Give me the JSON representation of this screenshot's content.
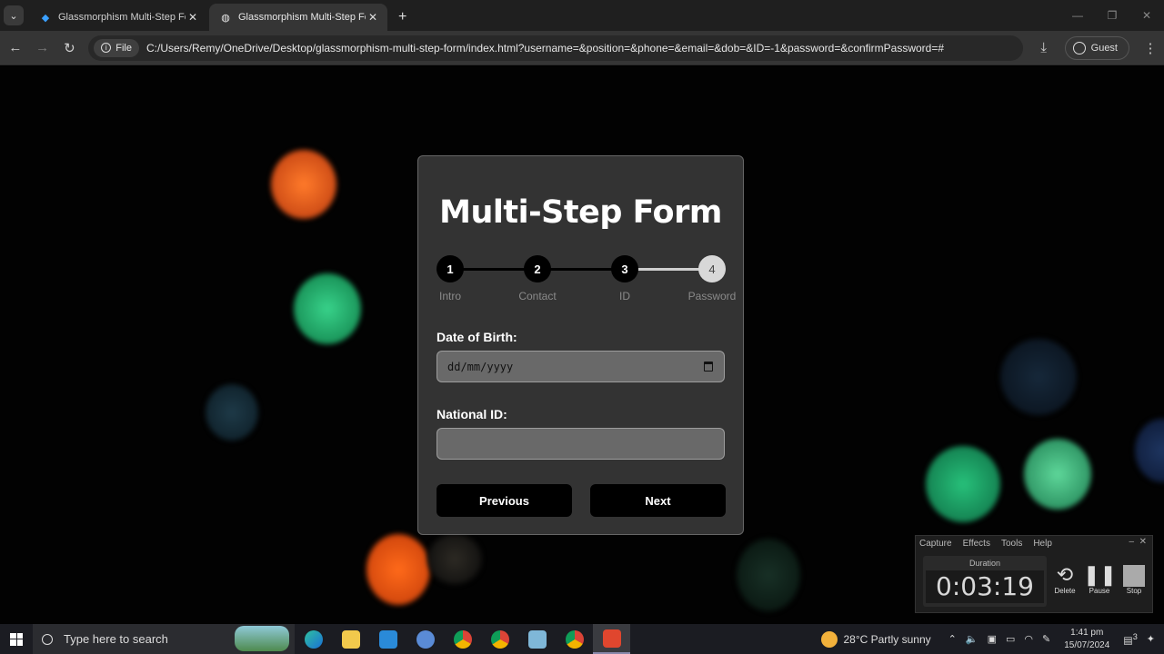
{
  "browser": {
    "tabs": [
      {
        "title": "Glassmorphism Multi-Step Form",
        "active": false
      },
      {
        "title": "Glassmorphism Multi-Step Form",
        "active": true
      }
    ],
    "new_tab": "+",
    "file_chip": "File",
    "url": "C:/Users/Remy/OneDrive/Desktop/glassmorphism-multi-step-form/index.html?username=&position=&phone=&email=&dob=&ID=-1&password=&confirmPassword=#",
    "profile_label": "Guest"
  },
  "form": {
    "title": "Multi-Step Form",
    "progress_fraction": 0.667,
    "steps": [
      {
        "number": "1",
        "label": "Intro",
        "done": true
      },
      {
        "number": "2",
        "label": "Contact",
        "done": true
      },
      {
        "number": "3",
        "label": "ID",
        "done": true
      },
      {
        "number": "4",
        "label": "Password",
        "done": false
      }
    ],
    "dob_label": "Date of Birth:",
    "dob_placeholder": "dd/mm/yyyy",
    "national_id_label": "National ID:",
    "national_id_value": "",
    "previous_label": "Previous",
    "next_label": "Next"
  },
  "recorder": {
    "menu": [
      "Capture",
      "Effects",
      "Tools",
      "Help"
    ],
    "duration_label": "Duration",
    "duration": "0:03:19",
    "delete_label": "Delete",
    "pause_label": "Pause",
    "stop_label": "Stop"
  },
  "taskbar": {
    "search_placeholder": "Type here to search",
    "weather": "28°C  Partly sunny",
    "time": "1:41 pm",
    "date": "15/07/2024",
    "notifications": "3"
  },
  "colors": {
    "accent": "#000000",
    "card_bg": "#464646",
    "bokeh_orange": "#e85a1a",
    "bokeh_green": "#19b36a"
  }
}
